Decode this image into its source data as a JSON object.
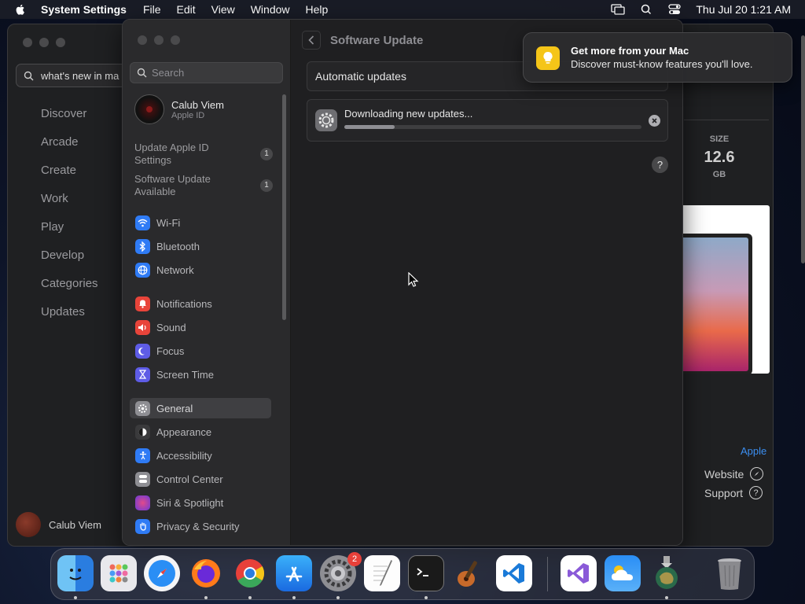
{
  "menubar": {
    "app_name": "System Settings",
    "menus": [
      "File",
      "Edit",
      "View",
      "Window",
      "Help"
    ],
    "datetime": "Thu Jul 20  1:21 AM"
  },
  "app_store": {
    "search_value": "what's new in ma",
    "nav": [
      "Discover",
      "Arcade",
      "Create",
      "Work",
      "Play",
      "Develop",
      "Categories",
      "Updates"
    ],
    "user_name": "Calub Viem",
    "size_label": "SIZE",
    "size_value": "12.6",
    "size_unit": "GB",
    "developer_link": "Apple",
    "website_label": "Website",
    "support_label": "Support"
  },
  "settings": {
    "search_placeholder": "Search",
    "user": {
      "name": "Calub Viem",
      "subtitle": "Apple ID"
    },
    "notices": [
      {
        "label": "Update Apple ID Settings",
        "count": "1"
      },
      {
        "label": "Software Update Available",
        "count": "1"
      }
    ],
    "items": [
      {
        "label": "Wi-Fi",
        "icon": "wifi-icon",
        "color": "#2f7bf5"
      },
      {
        "label": "Bluetooth",
        "icon": "bluetooth-icon",
        "color": "#2f7bf5"
      },
      {
        "label": "Network",
        "icon": "globe-icon",
        "color": "#2f7bf5"
      },
      {
        "label": "Notifications",
        "icon": "bell-icon",
        "color": "#e8443a"
      },
      {
        "label": "Sound",
        "icon": "speaker-icon",
        "color": "#e8443a"
      },
      {
        "label": "Focus",
        "icon": "moon-icon",
        "color": "#5e5ce6"
      },
      {
        "label": "Screen Time",
        "icon": "hourglass-icon",
        "color": "#5e5ce6"
      },
      {
        "label": "General",
        "icon": "gear-icon",
        "color": "#8e8e93"
      },
      {
        "label": "Appearance",
        "icon": "appearance-icon",
        "color": "#3a3a3c"
      },
      {
        "label": "Accessibility",
        "icon": "accessibility-icon",
        "color": "#2f7bf5"
      },
      {
        "label": "Control Center",
        "icon": "control-center-icon",
        "color": "#8e8e93"
      },
      {
        "label": "Siri & Spotlight",
        "icon": "siri-icon",
        "color": "#b04ad8"
      },
      {
        "label": "Privacy & Security",
        "icon": "hand-icon",
        "color": "#2f7bf5"
      }
    ],
    "selected": "General",
    "page_title": "Software Update",
    "automatic_updates_label": "Automatic updates",
    "download_text": "Downloading new updates...",
    "download_progress": 0.17,
    "help_label": "?"
  },
  "notification": {
    "title": "Get more from your Mac",
    "body": "Discover must-know features you'll love."
  },
  "dock": {
    "apps": [
      "Finder",
      "Launchpad",
      "Safari",
      "Firefox",
      "Chrome",
      "App Store",
      "System Settings",
      "TextEdit",
      "Terminal",
      "GarageBand",
      "Visual Studio Code",
      "Visual Studio",
      "Weather",
      "Xcode Installer",
      "Trash"
    ],
    "settings_badge": "2"
  }
}
